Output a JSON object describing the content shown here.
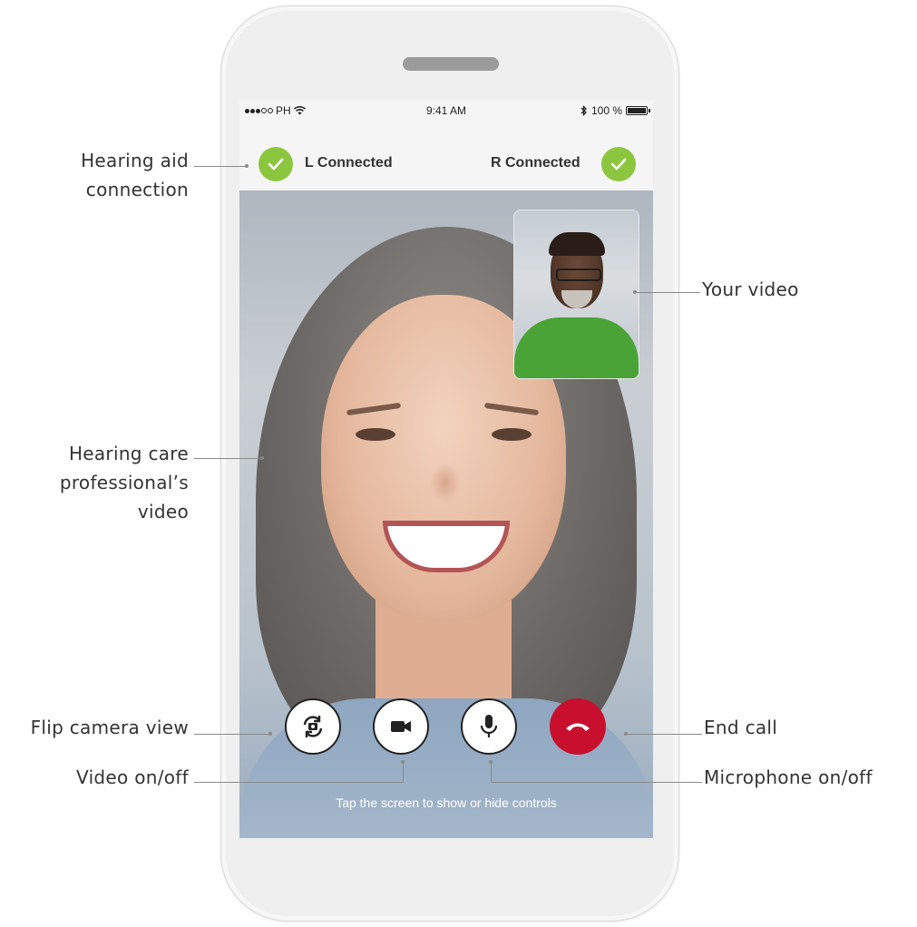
{
  "status_bar": {
    "carrier": "PH",
    "time": "9:41 AM",
    "battery": "100 %"
  },
  "connection": {
    "left_label": "L Connected",
    "right_label": "R Connected"
  },
  "controls": {
    "hint": "Tap the screen to show or hide controls",
    "buttons": [
      {
        "name": "flip-camera",
        "icon": "flip-camera-icon"
      },
      {
        "name": "video",
        "icon": "video-camera-icon"
      },
      {
        "name": "microphone",
        "icon": "microphone-icon"
      },
      {
        "name": "end-call",
        "icon": "end-call-icon"
      }
    ]
  },
  "annotations": {
    "hearing_aid_1": "Hearing aid",
    "hearing_aid_2": "connection",
    "your_video": "Your video",
    "hcp_1": "Hearing care",
    "hcp_2": "professional’s",
    "hcp_3": "video",
    "flip_camera": "Flip camera view",
    "video_toggle": "Video on/off",
    "end_call": "End call",
    "microphone": "Microphone on/off"
  },
  "colors": {
    "connected_green": "#8cc63f",
    "end_call_red": "#c8102e",
    "phone_body": "#efefef",
    "annotation_line": "#8a8a8a"
  }
}
